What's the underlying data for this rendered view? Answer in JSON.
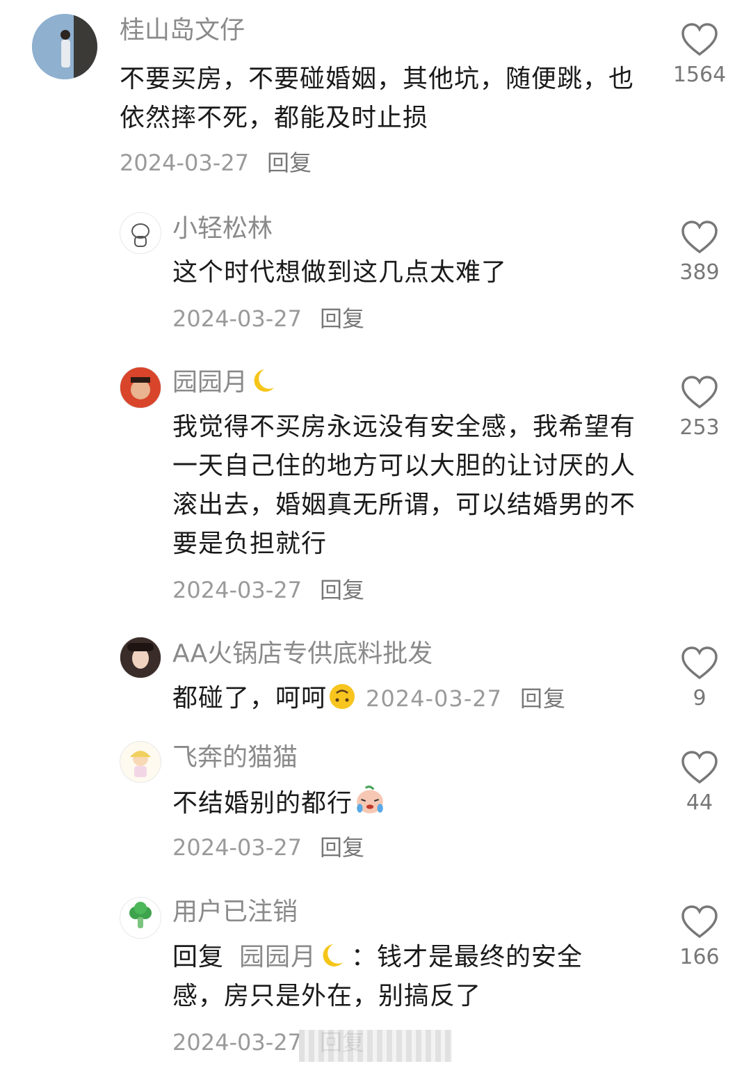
{
  "comments": [
    {
      "user": "桂山岛文仔",
      "text": "不要买房，不要碰婚姻，其他坑，随便跳，也依然摔不死，都能及时止损",
      "date": "2024-03-27",
      "reply": "回复",
      "likes": "1564"
    },
    {
      "user": "小轻松林",
      "text": "这个时代想做到这几点太难了",
      "date": "2024-03-27",
      "reply": "回复",
      "likes": "389"
    },
    {
      "user": "园园月",
      "text": "我觉得不买房永远没有安全感，我希望有一天自己住的地方可以大胆的让讨厌的人滚出去，婚姻真无所谓，可以结婚男的不要是负担就行",
      "date": "2024-03-27",
      "reply": "回复",
      "likes": "253"
    },
    {
      "user": "AA火锅店专供底料批发",
      "text": "都碰了，呵呵",
      "date": "2024-03-27",
      "reply": "回复",
      "likes": "9"
    },
    {
      "user": "飞奔的猫猫",
      "text": "不结婚别的都行",
      "date": "2024-03-27",
      "reply": "回复",
      "likes": "44"
    },
    {
      "user": "用户已注销",
      "reply_prefix": "回复",
      "reply_to": "园园月",
      "colon": "：",
      "text_line1": "钱才是最终的安全",
      "text_line2": "感，房只是外在，别搞反了",
      "date": "2024-03-27",
      "reply": "回复",
      "likes": "166"
    }
  ],
  "icons": {
    "like": "heart-outline-icon",
    "moon": "crescent-moon-emoji",
    "upside": "upside-down-face-emoji",
    "cry": "crying-face-emoji"
  },
  "colors": {
    "name": "#8a8a8a",
    "text": "#1a1a1a",
    "meta": "#9a9a9a"
  }
}
